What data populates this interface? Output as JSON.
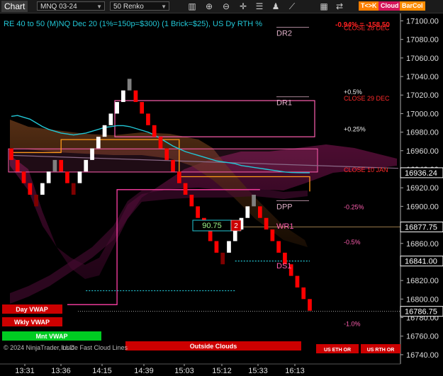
{
  "toolbar": {
    "title": "Chart",
    "instrument": "MNQ 03-24",
    "bar_type": "50 Renko",
    "icons": [
      "bar-chart-icon",
      "zoom-in-icon",
      "zoom-out-icon",
      "crosshair-icon",
      "properties-icon",
      "strategy-icon",
      "trend-icon",
      "grid-icon",
      "swap-icon"
    ],
    "buttons": [
      {
        "label": "T<>K",
        "color": "#ff7f00"
      },
      {
        "label": "Cloud",
        "color": "#d4145a"
      },
      {
        "label": "BarCol",
        "color": "#ff8c00"
      }
    ]
  },
  "header": {
    "info": "RE 40 to 50 (M)NQ Dec 20 (1%=150p=$300) (1 Brick=$25), US Dy RTH %",
    "change": "-0.94% = -158.50"
  },
  "colors": {
    "up_brick": "#ffffff",
    "up_brick_weak": "#808080",
    "down_brick": "#ff0000",
    "down_brick_weak": "#800000",
    "cyan_ma": "#22c7d6",
    "orange_line": "#ff9a1a",
    "pink_line": "#ff3fa6",
    "magenta_box": "#ff5fb0",
    "price_axis_bg": "#000000"
  },
  "chart_data": {
    "type": "renko",
    "brick_size": 12.5,
    "x_tick_labels": [
      "13:31",
      "13:36",
      "14:15",
      "14:39",
      "15:03",
      "15:12",
      "15:33",
      "16:13"
    ],
    "y_ticks": [
      16740,
      16760,
      16780,
      16800,
      16820,
      16840,
      16860,
      16880,
      16900,
      16920,
      16940,
      16960,
      16980,
      17000,
      17020,
      17040,
      17060,
      17080,
      17100
    ],
    "ylim": [
      16730,
      17108
    ],
    "bricks": [
      {
        "close": 16950,
        "dir": "down"
      },
      {
        "close": 16937.5,
        "dir": "down"
      },
      {
        "close": 16925,
        "dir": "down"
      },
      {
        "close": 16912.5,
        "dir": "down"
      },
      {
        "close": 16900,
        "dir": "down"
      },
      {
        "close": 16925,
        "dir": "up"
      },
      {
        "close": 16937.5,
        "dir": "up"
      },
      {
        "close": 16950,
        "dir": "up"
      },
      {
        "close": 16937.5,
        "dir": "down"
      },
      {
        "close": 16925,
        "dir": "down"
      },
      {
        "close": 16912.5,
        "dir": "down"
      },
      {
        "close": 16937.5,
        "dir": "up"
      },
      {
        "close": 16950,
        "dir": "up"
      },
      {
        "close": 16962.5,
        "dir": "up"
      },
      {
        "close": 16975,
        "dir": "up"
      },
      {
        "close": 16987.5,
        "dir": "up"
      },
      {
        "close": 17000,
        "dir": "up"
      },
      {
        "close": 17012.5,
        "dir": "up"
      },
      {
        "close": 17025,
        "dir": "up"
      },
      {
        "close": 17037.5,
        "dir": "up"
      },
      {
        "close": 17012.5,
        "dir": "down"
      },
      {
        "close": 17000,
        "dir": "down"
      },
      {
        "close": 16987.5,
        "dir": "down"
      },
      {
        "close": 16975,
        "dir": "down"
      },
      {
        "close": 16962.5,
        "dir": "down"
      },
      {
        "close": 16950,
        "dir": "down"
      },
      {
        "close": 16937.5,
        "dir": "down"
      },
      {
        "close": 16925,
        "dir": "down"
      },
      {
        "close": 16912.5,
        "dir": "down"
      },
      {
        "close": 16900,
        "dir": "down"
      },
      {
        "close": 16887.5,
        "dir": "down"
      },
      {
        "close": 16875,
        "dir": "down"
      },
      {
        "close": 16862.5,
        "dir": "down"
      },
      {
        "close": 16850,
        "dir": "down"
      },
      {
        "close": 16837.5,
        "dir": "down"
      },
      {
        "close": 16862.5,
        "dir": "up"
      },
      {
        "close": 16875,
        "dir": "up"
      },
      {
        "close": 16887.5,
        "dir": "up"
      },
      {
        "close": 16900,
        "dir": "up"
      },
      {
        "close": 16912.5,
        "dir": "up"
      },
      {
        "close": 16887.5,
        "dir": "down"
      },
      {
        "close": 16875,
        "dir": "down"
      },
      {
        "close": 16862.5,
        "dir": "down"
      },
      {
        "close": 16850,
        "dir": "down"
      },
      {
        "close": 16837.5,
        "dir": "down"
      },
      {
        "close": 16825,
        "dir": "down"
      },
      {
        "close": 16812.5,
        "dir": "down"
      },
      {
        "close": 16800,
        "dir": "down"
      },
      {
        "close": 16787.5,
        "dir": "down"
      }
    ],
    "cyan_ma": [
      16997,
      16998,
      16996,
      16994,
      16990,
      16986,
      16983,
      16981,
      16979,
      16978,
      16977,
      16978,
      16979,
      16981,
      16983,
      16985,
      16986,
      16987,
      16987,
      16986,
      16984,
      16982,
      16980,
      16977,
      16973,
      16969,
      16965,
      16962,
      16959,
      16957,
      16955,
      16953,
      16951,
      16949,
      16948,
      16947,
      16946,
      16944,
      16943,
      16942,
      16941,
      16940,
      16939,
      16938,
      16937,
      16936.5,
      16936.3,
      16936.2,
      16936.24
    ],
    "cyan_dotted": [
      {
        "from": 12,
        "to": 36,
        "y": 16809
      },
      {
        "from": 36,
        "to": 48,
        "y": 16841
      }
    ],
    "orange_level": [
      {
        "from": 0,
        "to": 8,
        "y": 16958
      },
      {
        "from": 8,
        "to": 12,
        "y": 16972
      },
      {
        "from": 12,
        "to": 27,
        "y": 16972
      },
      {
        "from": 27,
        "to": 33,
        "y": 16932
      },
      {
        "from": 33,
        "to": 48,
        "y": 16932
      }
    ],
    "pink_level": [
      {
        "from": 9,
        "to": 17,
        "y": 16794
      },
      {
        "from": 17,
        "to": 26,
        "y": 16918
      },
      {
        "from": 26,
        "to": 40,
        "y": 16918
      }
    ],
    "gray_trend": {
      "from_x": 0,
      "from_y": 16955,
      "to_x": 48,
      "to_y": 16941
    },
    "annotations": [
      {
        "text": "DR2",
        "price": 17087,
        "kind": "level"
      },
      {
        "text": "DR1",
        "price": 17012,
        "kind": "level"
      },
      {
        "text": "DPP",
        "price": 16900,
        "kind": "level"
      },
      {
        "text": "WR1",
        "price": 16879,
        "kind": "level-pink"
      },
      {
        "text": "DS1",
        "price": 16836,
        "kind": "level-pink"
      },
      {
        "text": "-0.94% = -158.50",
        "price": 17102,
        "kind": "pct-red"
      },
      {
        "text": "CLOSE 28 DEC",
        "price": 17093,
        "kind": "close-red"
      },
      {
        "text": "+0.5%",
        "price": 17024,
        "kind": "pct-white"
      },
      {
        "text": "CLOSE 29 DEC",
        "price": 17017,
        "kind": "close-red"
      },
      {
        "text": "+0.25%",
        "price": 16984,
        "kind": "pct-white"
      },
      {
        "text": "CLOSE 10 JAN",
        "price": 16940,
        "kind": "close-red"
      },
      {
        "text": "-0.25%",
        "price": 16900,
        "kind": "pct-pink"
      },
      {
        "text": "-0.5%",
        "price": 16862,
        "kind": "pct-pink"
      },
      {
        "text": "-1.0%",
        "price": 16774,
        "kind": "pct-pink"
      }
    ],
    "price_box": {
      "value": "90.75",
      "badge": "2"
    },
    "price_flags": [
      {
        "text": "16936.24",
        "price": 16936.24
      },
      {
        "text": "16877.75",
        "price": 16877.75
      },
      {
        "text": "16841.00",
        "price": 16841
      },
      {
        "text": "16786.75",
        "price": 16786.75
      }
    ],
    "grid": false
  },
  "bottom_labels": [
    {
      "text": "Day VWAP",
      "color": "#cc0000"
    },
    {
      "text": "Wkly VWAP",
      "color": "#cc0000"
    },
    {
      "text": "Mnt VWAP",
      "color": "#00cc22"
    },
    {
      "text": "Outside Clouds",
      "color": "#cc0000"
    },
    {
      "text": "US ETH OR",
      "color": "#cc0000"
    },
    {
      "text": "US RTH OR",
      "color": "#cc0000"
    }
  ],
  "copyright": "© 2024 NinjaTrader, LLC",
  "ghost_label": "Inside Fast Cloud Lines"
}
